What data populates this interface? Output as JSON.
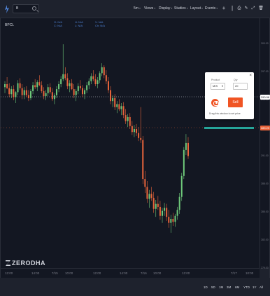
{
  "toolbar": {
    "symbol_search": "B",
    "menus": [
      {
        "label": "5m"
      },
      {
        "label": "Views"
      },
      {
        "label": "Display"
      },
      {
        "label": "Studies"
      },
      {
        "label": "Layout"
      },
      {
        "label": "Events"
      }
    ]
  },
  "chart": {
    "symbol": "BPCL",
    "ohlc_row1": [
      "O: N/A",
      "H: N/A",
      "V: N/A"
    ],
    "ohlc_row2": [
      "C: N/A",
      "L: N/A",
      "Ch: N/A"
    ],
    "watermark": "ZERODHA",
    "colors": {
      "up": "#6ec97a",
      "down": "#e8643b",
      "background": "#131722",
      "crosshair": "#d1d4dc",
      "price_line": "#e8643b",
      "bid_line": "#26a69a"
    }
  },
  "price_axis": {
    "ticks": [
      "300.00",
      "297.00",
      "294.00",
      "291.00",
      "288.00",
      "285.00",
      "282.00",
      "279.00"
    ],
    "crosshair_tag": "290.96",
    "last_price_tag": "289.29"
  },
  "time_axis": {
    "ticks": [
      "12:00",
      "14:00",
      "7/15",
      "10:00",
      "12:00",
      "14:00",
      "7/16",
      "10:00",
      "12:00",
      "7/17",
      "10:00"
    ]
  },
  "order_popup": {
    "product_label": "Product",
    "product_value": "MIS",
    "qty_label": "Qty",
    "qty_value": "20",
    "sell_label": "Sell",
    "hint": "Drag this window to set price",
    "close_symbol": "×"
  },
  "range_buttons": [
    "1D",
    "5D",
    "1M",
    "3M",
    "6M",
    "YTD",
    "1Y",
    "All"
  ],
  "candles": [
    [
      296.2,
      296.8,
      295.6,
      296.5
    ],
    [
      296.5,
      297.2,
      296.0,
      296.1
    ],
    [
      296.1,
      296.6,
      295.2,
      295.5
    ],
    [
      295.5,
      296.3,
      295.1,
      296.0
    ],
    [
      296.0,
      296.4,
      294.9,
      295.2
    ],
    [
      295.2,
      295.8,
      294.6,
      295.7
    ],
    [
      295.7,
      296.9,
      295.4,
      296.6
    ],
    [
      296.6,
      297.1,
      295.9,
      296.1
    ],
    [
      296.1,
      296.5,
      295.0,
      295.4
    ],
    [
      295.4,
      296.2,
      295.0,
      295.9
    ],
    [
      295.9,
      296.3,
      295.2,
      295.4
    ],
    [
      295.4,
      295.9,
      294.8,
      295.1
    ],
    [
      295.1,
      296.0,
      294.9,
      295.8
    ],
    [
      295.8,
      296.7,
      295.5,
      296.4
    ],
    [
      296.4,
      297.0,
      296.0,
      296.2
    ],
    [
      296.2,
      296.9,
      295.8,
      296.7
    ],
    [
      296.7,
      297.4,
      296.3,
      296.4
    ],
    [
      296.4,
      296.8,
      295.6,
      295.8
    ],
    [
      295.8,
      296.2,
      295.0,
      295.3
    ],
    [
      295.3,
      295.9,
      294.9,
      295.6
    ],
    [
      295.6,
      296.5,
      295.3,
      296.2
    ],
    [
      296.2,
      296.6,
      295.5,
      295.7
    ],
    [
      295.7,
      296.1,
      294.8,
      295.0
    ],
    [
      295.0,
      295.6,
      294.5,
      295.4
    ],
    [
      295.4,
      296.3,
      295.1,
      296.0
    ],
    [
      296.0,
      296.8,
      295.7,
      296.5
    ],
    [
      296.5,
      297.3,
      296.2,
      297.0
    ],
    [
      297.0,
      300.5,
      296.8,
      297.5
    ],
    [
      297.5,
      298.2,
      296.9,
      297.1
    ],
    [
      297.1,
      297.6,
      296.0,
      296.3
    ],
    [
      296.3,
      296.9,
      295.7,
      296.6
    ],
    [
      296.6,
      297.0,
      295.9,
      296.0
    ],
    [
      296.0,
      296.5,
      295.1,
      295.4
    ],
    [
      295.4,
      296.0,
      294.8,
      295.8
    ],
    [
      295.8,
      296.6,
      295.5,
      296.3
    ],
    [
      296.3,
      296.9,
      295.9,
      296.1
    ],
    [
      296.1,
      296.4,
      295.2,
      295.5
    ],
    [
      295.5,
      296.1,
      295.0,
      295.9
    ],
    [
      295.9,
      296.7,
      295.6,
      296.4
    ],
    [
      296.4,
      297.1,
      296.0,
      296.8
    ],
    [
      296.8,
      297.6,
      296.5,
      297.3
    ],
    [
      297.3,
      297.9,
      296.8,
      297.0
    ],
    [
      297.0,
      297.5,
      296.3,
      296.5
    ],
    [
      296.5,
      297.2,
      296.1,
      296.9
    ],
    [
      296.9,
      297.8,
      296.6,
      297.6
    ],
    [
      297.6,
      298.6,
      297.3,
      298.2
    ],
    [
      298.2,
      298.4,
      297.1,
      297.4
    ],
    [
      297.4,
      297.9,
      296.5,
      296.8
    ],
    [
      296.8,
      297.2,
      295.6,
      295.9
    ],
    [
      295.9,
      296.3,
      294.5,
      294.8
    ],
    [
      294.8,
      295.4,
      294.2,
      295.1
    ],
    [
      295.1,
      295.5,
      293.9,
      294.2
    ],
    [
      294.2,
      294.8,
      293.6,
      294.5
    ],
    [
      294.5,
      295.0,
      293.8,
      294.0
    ],
    [
      294.0,
      294.6,
      293.4,
      294.3
    ],
    [
      294.3,
      294.7,
      293.1,
      293.4
    ],
    [
      293.4,
      294.0,
      292.5,
      292.8
    ],
    [
      292.8,
      293.5,
      292.2,
      293.2
    ],
    [
      293.2,
      293.6,
      292.0,
      292.3
    ],
    [
      292.3,
      292.8,
      291.4,
      291.7
    ],
    [
      291.7,
      292.4,
      291.2,
      292.0
    ],
    [
      292.0,
      292.5,
      291.3,
      291.6
    ],
    [
      291.6,
      292.2,
      290.8,
      291.1
    ],
    [
      291.1,
      294.2,
      290.6,
      290.9
    ],
    [
      290.9,
      291.3,
      286.5,
      287.0
    ],
    [
      287.0,
      287.8,
      285.6,
      286.2
    ],
    [
      286.2,
      286.8,
      284.6,
      285.0
    ],
    [
      285.0,
      285.9,
      284.1,
      285.5
    ],
    [
      285.5,
      286.2,
      284.8,
      285.1
    ],
    [
      285.1,
      285.7,
      283.6,
      284.0
    ],
    [
      284.0,
      284.9,
      283.2,
      284.5
    ],
    [
      284.5,
      285.3,
      283.9,
      284.2
    ],
    [
      284.2,
      284.8,
      282.9,
      283.3
    ],
    [
      283.3,
      284.1,
      282.6,
      283.8
    ],
    [
      283.8,
      284.6,
      283.3,
      284.1
    ],
    [
      284.1,
      284.5,
      282.8,
      283.2
    ],
    [
      283.2,
      283.9,
      282.1,
      282.6
    ],
    [
      282.6,
      283.4,
      281.6,
      283.0
    ],
    [
      283.0,
      283.6,
      282.3,
      282.7
    ],
    [
      282.7,
      283.5,
      282.2,
      283.3
    ],
    [
      283.3,
      284.2,
      282.9,
      283.9
    ],
    [
      283.9,
      285.6,
      283.5,
      285.2
    ],
    [
      285.2,
      287.6,
      284.8,
      287.3
    ],
    [
      287.3,
      290.2,
      287.0,
      289.9
    ],
    [
      289.9,
      291.5,
      289.4,
      290.6
    ],
    [
      290.6,
      291.2,
      289.0,
      289.3
    ]
  ]
}
